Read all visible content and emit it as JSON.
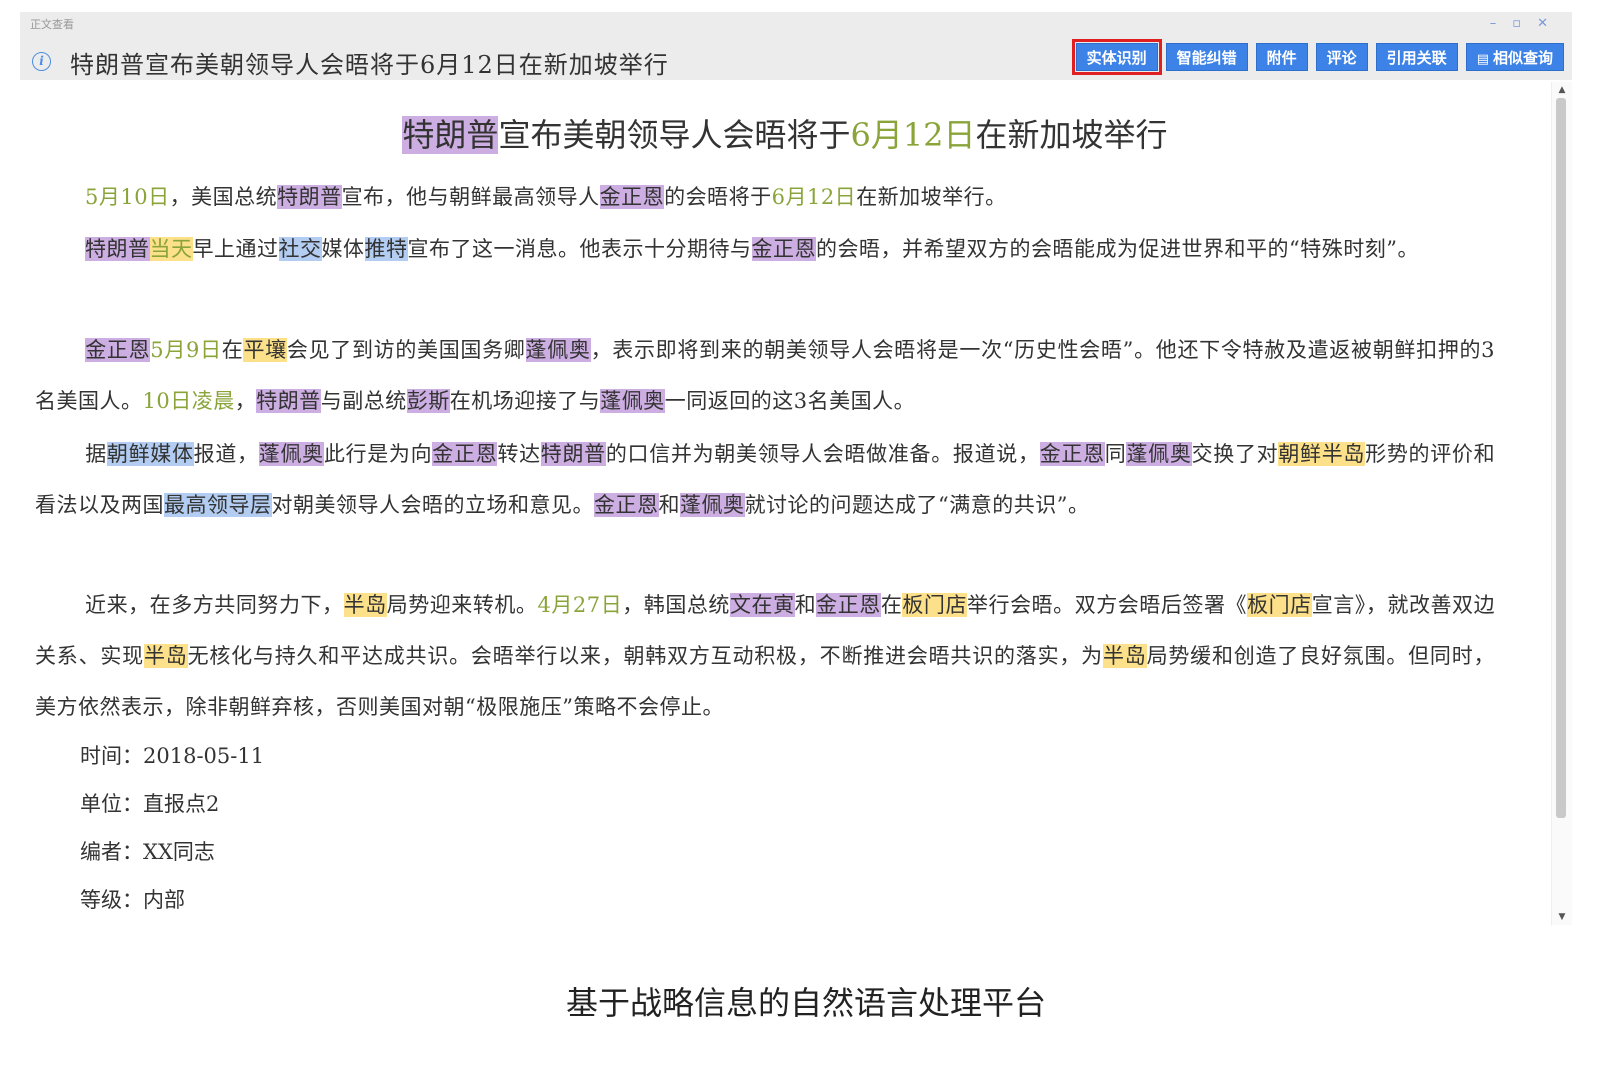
{
  "window": {
    "app_name": "正文查看",
    "controls": {
      "minimize": "–",
      "restore": "▫",
      "close": "✕"
    }
  },
  "header": {
    "info_icon": "i",
    "title": "特朗普宣布美朝领导人会晤将于6月12日在新加坡举行"
  },
  "toolbar": {
    "entity_recognition": "实体识别",
    "smart_correction": "智能纠错",
    "attachments": "附件",
    "comments": "评论",
    "citation_links": "引用关联",
    "similar_search": "相似查询",
    "active_button": "实体识别"
  },
  "article": {
    "title_parts": [
      {
        "text": "特朗普",
        "type": "person"
      },
      {
        "text": "宣布美朝领导人会晤将于",
        "type": "plain"
      },
      {
        "text": "6月12日",
        "type": "time"
      },
      {
        "text": "在新加坡举行",
        "type": "plain"
      }
    ],
    "paragraphs": [
      [
        {
          "text": "5月10日",
          "type": "time"
        },
        {
          "text": "，美国总统",
          "type": "plain"
        },
        {
          "text": "特朗普",
          "type": "person"
        },
        {
          "text": "宣布，他与朝鲜最高领导人",
          "type": "plain"
        },
        {
          "text": "金正恩",
          "type": "person"
        },
        {
          "text": "的会晤将于",
          "type": "plain"
        },
        {
          "text": "6月12日",
          "type": "time"
        },
        {
          "text": "在新加坡举行。",
          "type": "plain"
        }
      ],
      [
        {
          "text": "特朗普",
          "type": "person"
        },
        {
          "text": "当天",
          "type": "time-hl"
        },
        {
          "text": "早上通过",
          "type": "plain"
        },
        {
          "text": "社交",
          "type": "org"
        },
        {
          "text": "媒体",
          "type": "plain"
        },
        {
          "text": "推特",
          "type": "org"
        },
        {
          "text": "宣布了这一消息。他表示十分期待与",
          "type": "plain"
        },
        {
          "text": "金正恩",
          "type": "person"
        },
        {
          "text": "的会晤，并希望双方的会晤能成为促进世界和平的“特殊时刻”。",
          "type": "plain"
        }
      ],
      [
        {
          "text": "金正恩",
          "type": "person"
        },
        {
          "text": "5月9日",
          "type": "time"
        },
        {
          "text": "在",
          "type": "plain"
        },
        {
          "text": "平壤",
          "type": "location"
        },
        {
          "text": "会见了到访的美国国务卿",
          "type": "plain"
        },
        {
          "text": "蓬佩奥",
          "type": "person"
        },
        {
          "text": "，表示即将到来的朝美领导人会晤将是一次“历史性会晤”。他还下令特赦及遣返被朝鲜扣押的3名美国人。",
          "type": "plain"
        },
        {
          "text": "10日凌晨",
          "type": "time"
        },
        {
          "text": "，",
          "type": "plain"
        },
        {
          "text": "特朗普",
          "type": "person"
        },
        {
          "text": "与副总统",
          "type": "plain"
        },
        {
          "text": "彭斯",
          "type": "person"
        },
        {
          "text": "在机场迎接了与",
          "type": "plain"
        },
        {
          "text": "蓬佩奥",
          "type": "person"
        },
        {
          "text": "一同返回的这3名美国人。",
          "type": "plain"
        }
      ],
      [
        {
          "text": "据",
          "type": "plain"
        },
        {
          "text": "朝鲜媒体",
          "type": "org"
        },
        {
          "text": "报道，",
          "type": "plain"
        },
        {
          "text": "蓬佩奥",
          "type": "person"
        },
        {
          "text": "此行是为向",
          "type": "plain"
        },
        {
          "text": "金正恩",
          "type": "person"
        },
        {
          "text": "转达",
          "type": "plain"
        },
        {
          "text": "特朗普",
          "type": "person"
        },
        {
          "text": "的口信并为朝美领导人会晤做准备。报道说，",
          "type": "plain"
        },
        {
          "text": "金正恩",
          "type": "person"
        },
        {
          "text": "同",
          "type": "plain"
        },
        {
          "text": "蓬佩奥",
          "type": "person"
        },
        {
          "text": "交换了对",
          "type": "plain"
        },
        {
          "text": "朝鲜半岛",
          "type": "location"
        },
        {
          "text": "形势的评价和看法以及两国",
          "type": "plain"
        },
        {
          "text": "最高领导层",
          "type": "org"
        },
        {
          "text": "对朝美领导人会晤的立场和意见。",
          "type": "plain"
        },
        {
          "text": "金正恩",
          "type": "person"
        },
        {
          "text": "和",
          "type": "plain"
        },
        {
          "text": "蓬佩奥",
          "type": "person"
        },
        {
          "text": "就讨论的问题达成了“满意的共识”。",
          "type": "plain"
        }
      ],
      [
        {
          "text": "近来，在多方共同努力下，",
          "type": "plain"
        },
        {
          "text": "半岛",
          "type": "location"
        },
        {
          "text": "局势迎来转机。",
          "type": "plain"
        },
        {
          "text": "4月27日",
          "type": "time"
        },
        {
          "text": "，韩国总统",
          "type": "plain"
        },
        {
          "text": "文在寅",
          "type": "person"
        },
        {
          "text": "和",
          "type": "plain"
        },
        {
          "text": "金正恩",
          "type": "person"
        },
        {
          "text": "在",
          "type": "plain"
        },
        {
          "text": "板门店",
          "type": "location"
        },
        {
          "text": "举行会晤。双方会晤后签署《",
          "type": "plain"
        },
        {
          "text": "板门店",
          "type": "location"
        },
        {
          "text": "宣言》，就改善双边关系、实现",
          "type": "plain"
        },
        {
          "text": "半岛",
          "type": "location"
        },
        {
          "text": "无核化与持久和平达成共识。会晤举行以来，朝韩双方互动积极，不断推进会晤共识的落实，为",
          "type": "plain"
        },
        {
          "text": "半岛",
          "type": "location"
        },
        {
          "text": "局势缓和创造了良好氛围。但同时，美方依然表示，除非朝鲜弃核，否则美国对朝“极限施压”策略不会停止。",
          "type": "plain"
        }
      ]
    ],
    "meta": {
      "time": "时间：2018-05-11",
      "unit": "单位：直报点2",
      "editor": "编者：XX同志",
      "level": "等级：内部"
    }
  },
  "colors": {
    "person": "#cdaee2",
    "time": "#8aa43a",
    "location": "#fde08a",
    "org": "#b3cdf2",
    "toolbar_button": "#3d82e6",
    "active_outline": "#e02020"
  },
  "caption": "基于战略信息的自然语言处理平台"
}
